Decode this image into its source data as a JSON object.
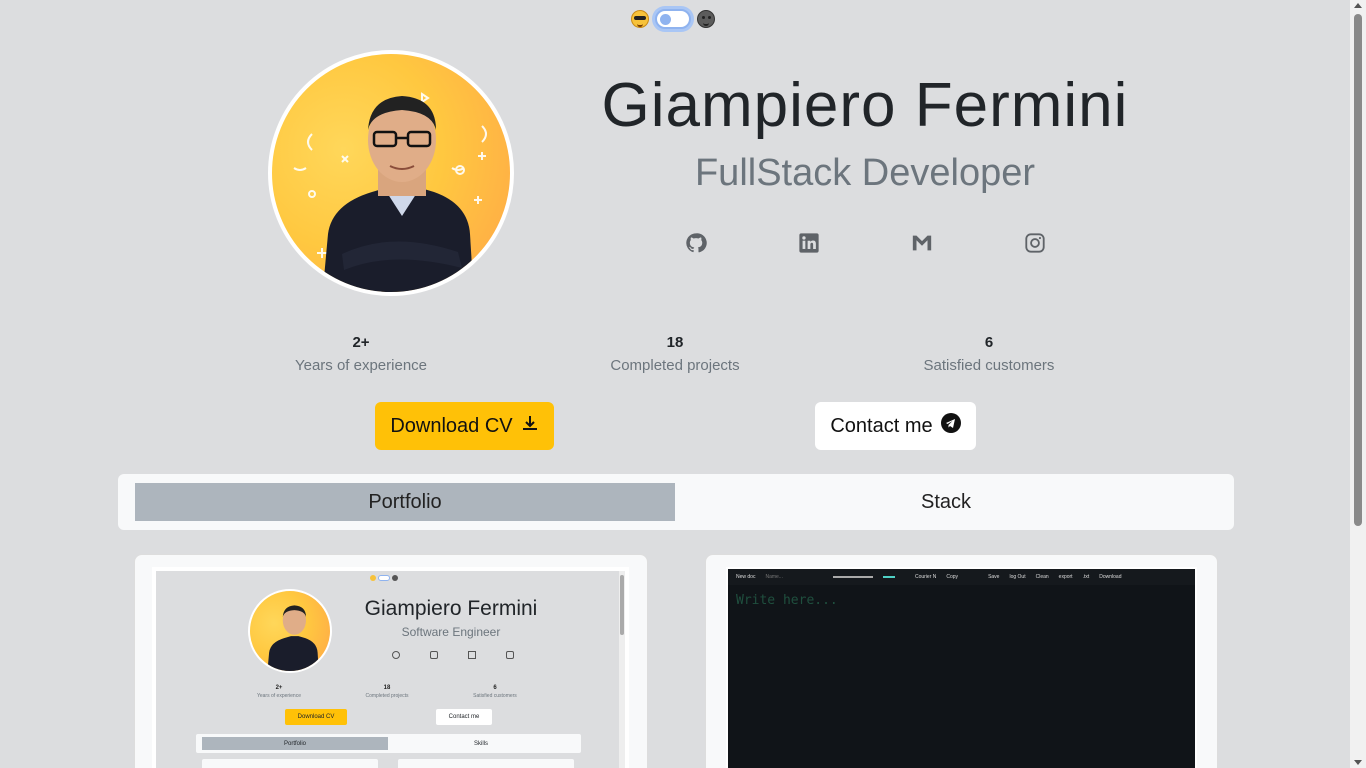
{
  "theme": {
    "light_icon": "sunglasses-emoji-icon",
    "dark_icon": "dark-face-emoji-icon",
    "toggle_state": "light"
  },
  "profile": {
    "name": "Giampiero Fermini",
    "role": "FullStack Developer",
    "socials": [
      {
        "name": "GitHub",
        "icon": "github-icon"
      },
      {
        "name": "LinkedIn",
        "icon": "linkedin-icon"
      },
      {
        "name": "Gmail",
        "icon": "gmail-icon"
      },
      {
        "name": "Instagram",
        "icon": "instagram-icon"
      }
    ]
  },
  "stats": [
    {
      "value": "2+",
      "label": "Years of experience"
    },
    {
      "value": "18",
      "label": "Completed projects"
    },
    {
      "value": "6",
      "label": "Satisfied customers"
    }
  ],
  "actions": {
    "download_cv": "Download CV",
    "contact_me": "Contact me"
  },
  "tabs": [
    {
      "label": "Portfolio",
      "active": true
    },
    {
      "label": "Stack",
      "active": false
    }
  ],
  "portfolio": {
    "card1": {
      "name": "Giampiero Fermini",
      "role": "Software Engineer",
      "stats": [
        {
          "value": "2+",
          "label": "Years of experience"
        },
        {
          "value": "18",
          "label": "Completed projects"
        },
        {
          "value": "6",
          "label": "Satisfied customers"
        }
      ],
      "download_cv": "Download CV",
      "contact_me": "Contact me",
      "tab_a": "Portfolio",
      "tab_b": "Skills"
    },
    "card2": {
      "toolbar": [
        "New doc",
        "Name...",
        "Courier N",
        "Copy",
        "Save",
        "log Out",
        "Clean",
        "export",
        ".txt",
        "Download"
      ],
      "placeholder": "Write here..."
    }
  },
  "colors": {
    "background": "#dcdddf",
    "accent_yellow": "#ffc107",
    "tab_active": "#adb5bd",
    "editor_bg": "#101418"
  }
}
